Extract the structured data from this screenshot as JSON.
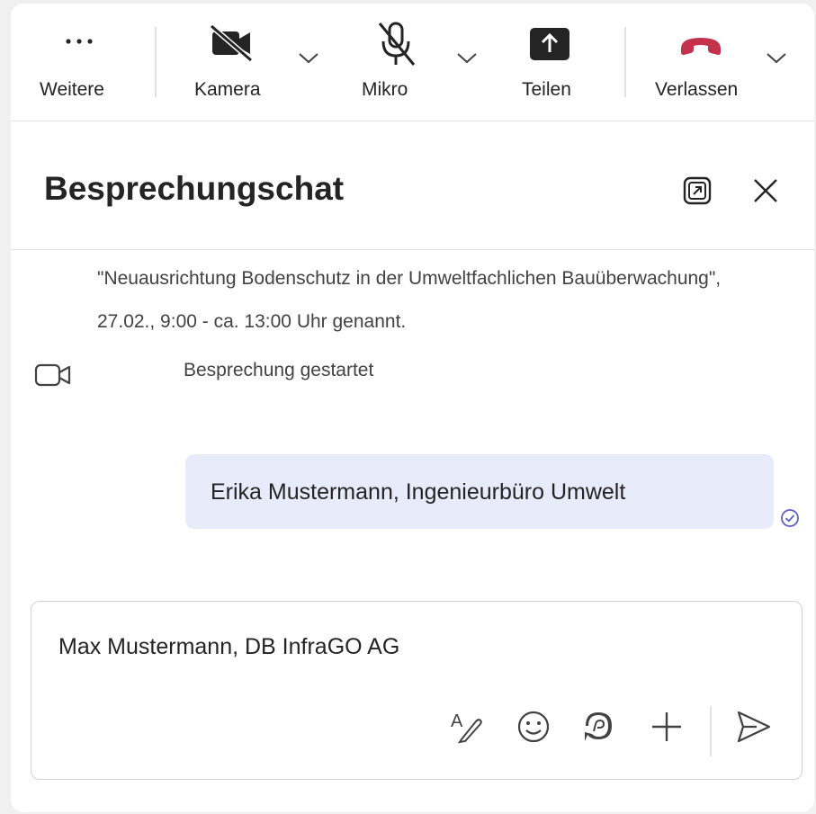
{
  "toolbar": {
    "more_label": "Weitere",
    "camera_label": "Kamera",
    "mic_label": "Mikro",
    "share_label": "Teilen",
    "leave_label": "Verlassen",
    "leave_color": "#c4314b"
  },
  "chat": {
    "title": "Besprechungschat",
    "system_message": "\"Neuausrichtung Bodenschutz in der Umweltfachlichen Bauüberwachung\", 27.02., 9:00 - ca. 13:00 Uhr genannt.",
    "event_text": "Besprechung gestartet",
    "sent_message": "Erika Mustermann, Ingenieurbüro Umwelt",
    "bubble_color": "#e8ebfa",
    "read_status_color": "#5b5fc7"
  },
  "compose": {
    "value": "Max Mustermann, DB InfraGO AG"
  },
  "icons": {
    "more": "more-horizontal-icon",
    "camera": "video-off-icon",
    "mic": "mic-off-icon",
    "share": "share-screen-icon",
    "leave": "phone-hangup-icon",
    "popout": "pop-out-icon",
    "close": "close-icon",
    "event": "video-camera-icon",
    "read": "read-receipt-icon",
    "format": "format-icon",
    "emoji": "emoji-icon",
    "loop": "loop-icon",
    "attach": "add-icon",
    "send": "send-icon"
  }
}
